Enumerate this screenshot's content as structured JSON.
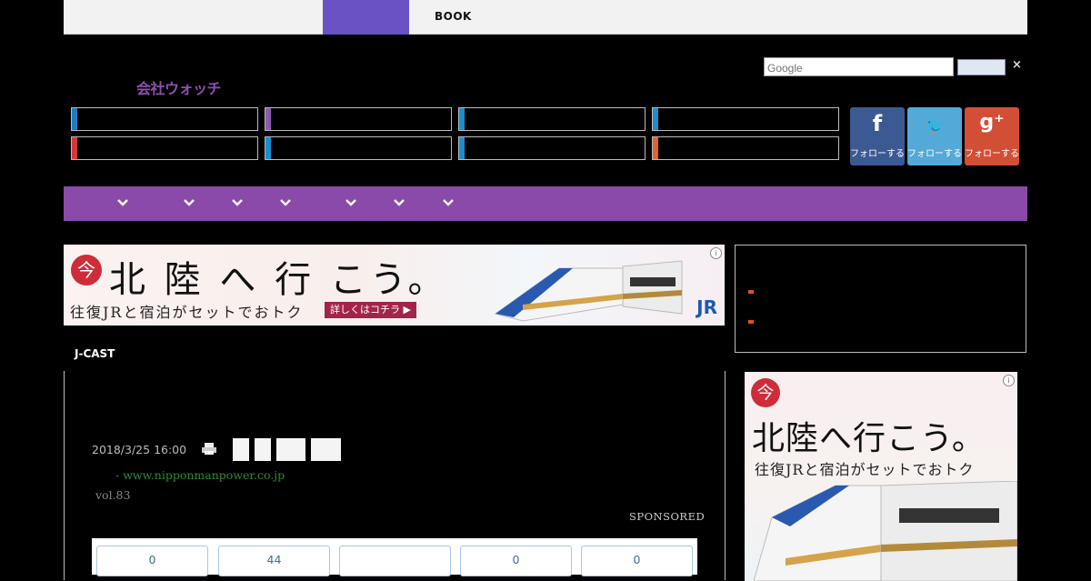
{
  "topnav": {
    "book_label": "BOOK"
  },
  "logo": {
    "text": "会社ウォッチ"
  },
  "search": {
    "placeholder": "Google",
    "close_glyph": "×"
  },
  "categories": {
    "stripe_colors": [
      "#1a7ec4",
      "#8a5cad",
      "#1a8ecf",
      "#1a8ecf",
      "#d63838",
      "#1a8ecf",
      "#1a8ecf",
      "#e3622f"
    ]
  },
  "social": [
    {
      "glyph": "f",
      "label": "フォローする",
      "color": "#3b5a94",
      "icon": "facebook-icon"
    },
    {
      "glyph": "🐦",
      "label": "フォローする",
      "color": "#53a9d8",
      "icon": "twitter-icon"
    },
    {
      "glyph": "g⁺",
      "label": "フォローする",
      "color": "#d24e35",
      "icon": "google-plus-icon"
    }
  ],
  "ads": {
    "banner": {
      "ima": "今",
      "headline": "北 陸 へ 行 こう。",
      "subline": "往復JRと宿泊がセットでおトク",
      "cta": "詳しくはコチラ ▶",
      "brand": "JR"
    },
    "side": {
      "ima": "今",
      "headline": "北陸へ行こう。",
      "subline": "往復JRと宿泊がセットでおトク"
    }
  },
  "article": {
    "source": "J-CAST",
    "date": "2018/3/25 16:00",
    "sponsor_link": "-  www.nipponmanpower.co.jp",
    "vol": "vol.83",
    "sponsored_label": "SPONSORED"
  },
  "share_counts": [
    "0",
    "44",
    "",
    "0",
    "0"
  ]
}
